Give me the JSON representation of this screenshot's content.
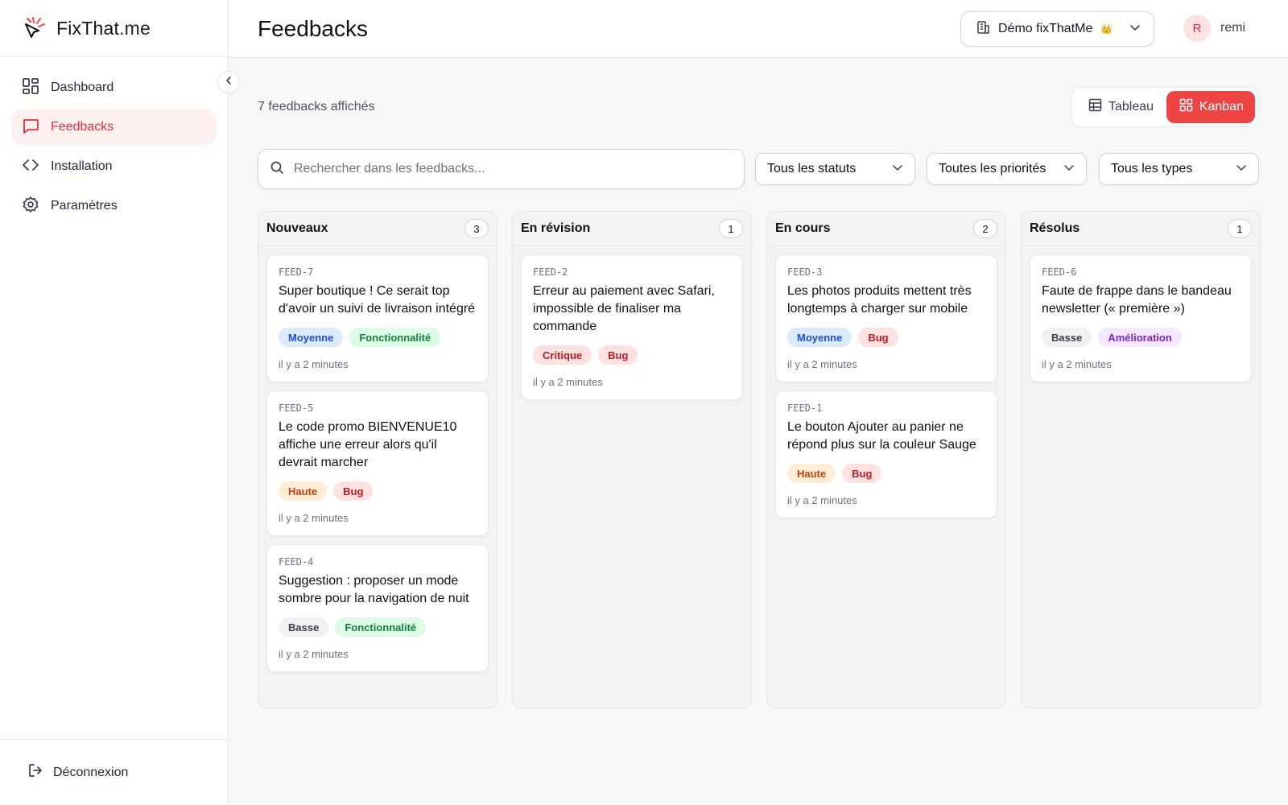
{
  "app": {
    "brand_name": "FixThat",
    "brand_tld": ".me"
  },
  "sidebar": {
    "items": [
      {
        "label": "Dashboard",
        "icon": "dashboard-icon"
      },
      {
        "label": "Feedbacks",
        "icon": "message-square-icon",
        "active": true
      },
      {
        "label": "Installation",
        "icon": "code-icon"
      },
      {
        "label": "Paramètres",
        "icon": "gear-icon"
      }
    ],
    "logout_label": "Déconnexion"
  },
  "header": {
    "title": "Feedbacks",
    "org_name": "Démo fixThatMe",
    "org_badge": "👑",
    "user_initial": "R",
    "user_name": "remi"
  },
  "main": {
    "count_text": "7 feedbacks affichés",
    "view_toggle": {
      "table_label": "Tableau",
      "kanban_label": "Kanban",
      "active": "kanban"
    },
    "search_placeholder": "Rechercher dans les feedbacks...",
    "filters": {
      "status": "Tous les statuts",
      "priority": "Toutes les priorités",
      "type": "Tous les types"
    }
  },
  "colors": {
    "accent": "#ef4444",
    "priority_moyenne": "#1d4ed8",
    "priority_haute": "#c2410c",
    "priority_critique": "#b91c1c",
    "priority_basse": "#374151",
    "type_fonctionnalite": "#15803d",
    "type_bug": "#b91c1c",
    "type_amelioration": "#7e22ce"
  },
  "kanban": {
    "columns": [
      {
        "title": "Nouveaux",
        "count": "3",
        "cards": [
          {
            "id": "FEED-7",
            "title": "Super boutique ! Ce serait top d'avoir un suivi de livraison intégré",
            "priority": "Moyenne",
            "type": "Fonctionnalité",
            "time": "il y a 2 minutes"
          },
          {
            "id": "FEED-5",
            "title": "Le code promo BIENVENUE10 affiche une erreur alors qu'il devrait marcher",
            "priority": "Haute",
            "type": "Bug",
            "time": "il y a 2 minutes"
          },
          {
            "id": "FEED-4",
            "title": "Suggestion : proposer un mode sombre pour la navigation de nuit",
            "priority": "Basse",
            "type": "Fonctionnalité",
            "time": "il y a 2 minutes"
          }
        ]
      },
      {
        "title": "En révision",
        "count": "1",
        "cards": [
          {
            "id": "FEED-2",
            "title": "Erreur au paiement avec Safari, impossible de finaliser ma commande",
            "priority": "Critique",
            "type": "Bug",
            "time": "il y a 2 minutes"
          }
        ]
      },
      {
        "title": "En cours",
        "count": "2",
        "cards": [
          {
            "id": "FEED-3",
            "title": "Les photos produits mettent très longtemps à charger sur mobile",
            "priority": "Moyenne",
            "type": "Bug",
            "time": "il y a 2 minutes"
          },
          {
            "id": "FEED-1",
            "title": "Le bouton Ajouter au panier ne répond plus sur la couleur Sauge",
            "priority": "Haute",
            "type": "Bug",
            "time": "il y a 2 minutes"
          }
        ]
      },
      {
        "title": "Résolus",
        "count": "1",
        "cards": [
          {
            "id": "FEED-6",
            "title": "Faute de frappe dans le bandeau newsletter (« première »)",
            "priority": "Basse",
            "type": "Amélioration",
            "time": "il y a 2 minutes"
          }
        ]
      }
    ]
  }
}
